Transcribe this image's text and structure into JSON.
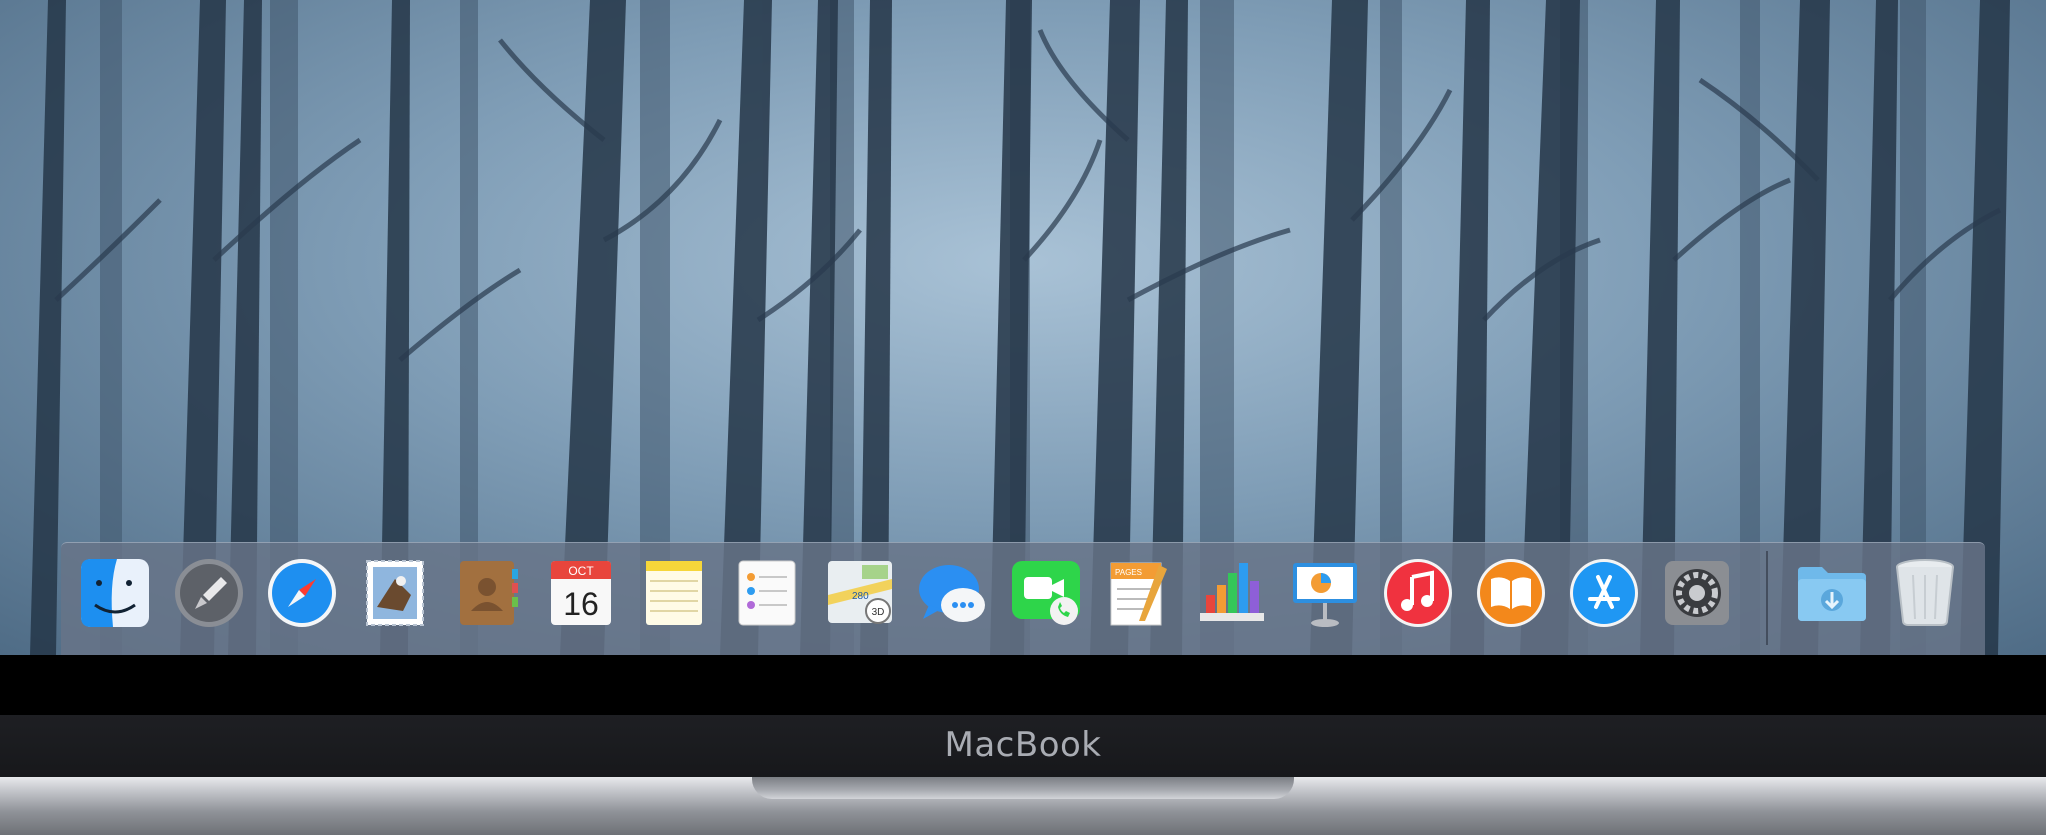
{
  "dock": {
    "items": [
      {
        "name": "finder-icon",
        "running": true
      },
      {
        "name": "launchpad-icon",
        "running": false
      },
      {
        "name": "safari-icon",
        "running": false
      },
      {
        "name": "mail-icon",
        "running": false
      },
      {
        "name": "contacts-icon",
        "running": false
      },
      {
        "name": "calendar-icon",
        "running": false,
        "month": "OCT",
        "day": "16"
      },
      {
        "name": "notes-icon",
        "running": false
      },
      {
        "name": "reminders-icon",
        "running": false
      },
      {
        "name": "maps-icon",
        "running": false,
        "badge": "3D",
        "route": "280"
      },
      {
        "name": "messages-icon",
        "running": false
      },
      {
        "name": "facetime-icon",
        "running": false
      },
      {
        "name": "pages-icon",
        "running": false,
        "label": "PAGES"
      },
      {
        "name": "numbers-icon",
        "running": false
      },
      {
        "name": "keynote-icon",
        "running": false
      },
      {
        "name": "itunes-icon",
        "running": false
      },
      {
        "name": "ibooks-icon",
        "running": false
      },
      {
        "name": "app-store-icon",
        "running": false
      },
      {
        "name": "system-preferences-icon",
        "running": false
      },
      {
        "name": "downloads-folder-icon",
        "running": false
      },
      {
        "name": "trash-icon",
        "running": false
      }
    ]
  },
  "device": {
    "label": "MacBook"
  },
  "colors": {
    "sky": "#8fadc4",
    "dock": "#687488",
    "bezel": "#1b1c20",
    "safari": "#1e8ff0",
    "itunes": "#f0323f",
    "ibooks": "#f3881b",
    "app_store": "#1f97f3",
    "facetime": "#2ed54a"
  }
}
